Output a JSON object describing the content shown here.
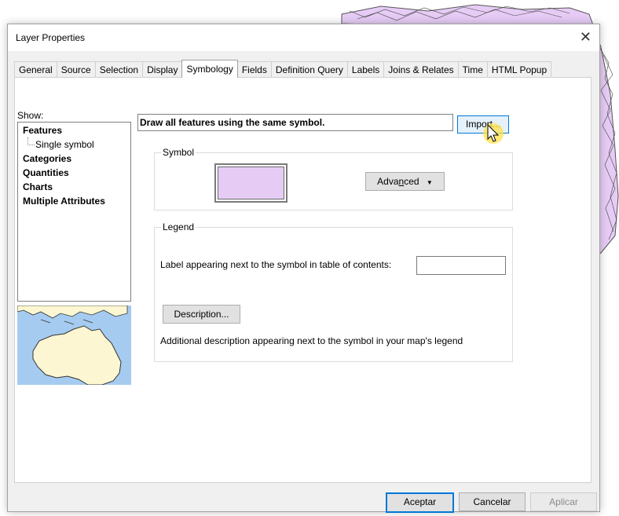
{
  "dialog": {
    "title": "Layer Properties",
    "close_symbol": "✕"
  },
  "tabs": [
    "General",
    "Source",
    "Selection",
    "Display",
    "Symbology",
    "Fields",
    "Definition Query",
    "Labels",
    "Joins & Relates",
    "Time",
    "HTML Popup"
  ],
  "active_tab": "Symbology",
  "show": {
    "label": "Show:",
    "items": [
      "Features",
      "Single symbol",
      "Categories",
      "Quantities",
      "Charts",
      "Multiple Attributes"
    ]
  },
  "renderer": {
    "description": "Draw all features using the same symbol.",
    "import_label": "Import..."
  },
  "symbol_group": {
    "label": "Symbol",
    "fill_color": "#e6ccf5",
    "advanced_label": "Advanced",
    "advanced_mnemonic": "n"
  },
  "legend_group": {
    "label": "Legend",
    "label_text": "Label appearing next to the symbol in table of contents:",
    "label_value": "",
    "description_button": "Description...",
    "additional_text": "Additional description appearing next to the symbol in your map's legend"
  },
  "buttons": {
    "ok": "Aceptar",
    "cancel": "Cancelar",
    "apply": "Aplicar"
  },
  "colors": {
    "accent": "#0078d7",
    "map_ocean": "#a6cbf0",
    "map_land": "#fcf7d2",
    "layer_fill": "#e6ccf5"
  }
}
